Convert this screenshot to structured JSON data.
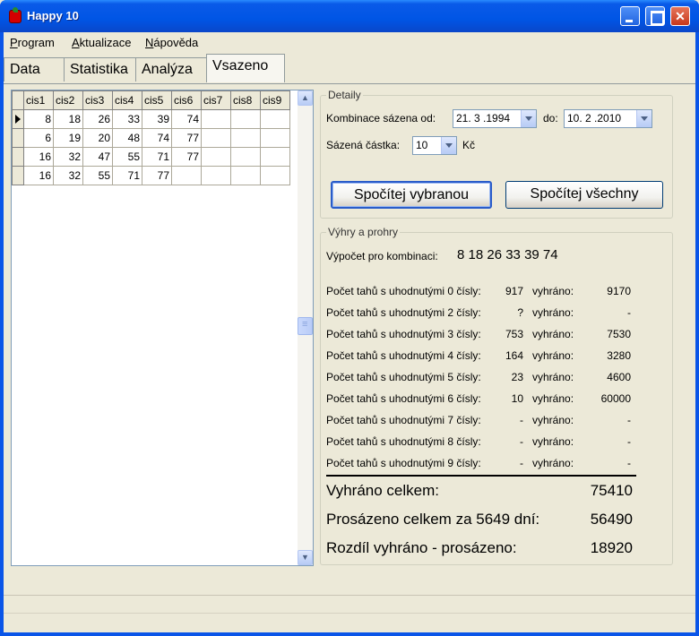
{
  "window": {
    "title": "Happy 10"
  },
  "menu": [
    {
      "label": "Program",
      "accel": "P"
    },
    {
      "label": "Aktualizace",
      "accel": "A"
    },
    {
      "label": "Nápověda",
      "accel": "N"
    }
  ],
  "tabs": [
    {
      "label": "Data"
    },
    {
      "label": "Statistika"
    },
    {
      "label": "Analýza"
    },
    {
      "label": "Vsazeno"
    }
  ],
  "grid": {
    "headers": [
      "cis1",
      "cis2",
      "cis3",
      "cis4",
      "cis5",
      "cis6",
      "cis7",
      "cis8",
      "cis9"
    ],
    "rows": [
      [
        "8",
        "18",
        "26",
        "33",
        "39",
        "74",
        "",
        "",
        ""
      ],
      [
        "6",
        "19",
        "20",
        "48",
        "74",
        "77",
        "",
        "",
        ""
      ],
      [
        "16",
        "32",
        "47",
        "55",
        "71",
        "77",
        "",
        "",
        ""
      ],
      [
        "16",
        "32",
        "55",
        "71",
        "77",
        "",
        "",
        "",
        ""
      ]
    ],
    "current_row": 0
  },
  "details": {
    "legend": "Detaily",
    "from_label": "Kombinace sázena od:",
    "from_value": "21. 3 .1994",
    "to_label": "do:",
    "to_value": "10. 2 .2010",
    "amount_label": "Sázená částka:",
    "amount_value": "10",
    "currency": "Kč",
    "btn_selected": "Spočítej vybranou",
    "btn_all": "Spočítej všechny"
  },
  "results": {
    "legend": "Výhry a prohry",
    "combo_label": "Výpočet pro kombinaci:",
    "combo_value": "8 18 26 33 39 74",
    "rows": [
      {
        "label": "Počet tahů s uhodnutými 0 čísly:",
        "count": "917",
        "won_label": "vyhráno:",
        "won": "9170"
      },
      {
        "label": "Počet tahů s uhodnutými 2 čísly:",
        "count": "?",
        "won_label": "vyhráno:",
        "won": "-"
      },
      {
        "label": "Počet tahů s uhodnutými 3 čísly:",
        "count": "753",
        "won_label": "vyhráno:",
        "won": "7530"
      },
      {
        "label": "Počet tahů s uhodnutými 4 čísly:",
        "count": "164",
        "won_label": "vyhráno:",
        "won": "3280"
      },
      {
        "label": "Počet tahů s uhodnutými 5 čísly:",
        "count": "23",
        "won_label": "vyhráno:",
        "won": "4600"
      },
      {
        "label": "Počet tahů s uhodnutými 6 čísly:",
        "count": "10",
        "won_label": "vyhráno:",
        "won": "60000"
      },
      {
        "label": "Počet tahů s uhodnutými 7 čísly:",
        "count": "-",
        "won_label": "vyhráno:",
        "won": "-"
      },
      {
        "label": "Počet tahů s uhodnutými 8 čísly:",
        "count": "-",
        "won_label": "vyhráno:",
        "won": "-"
      },
      {
        "label": "Počet tahů s uhodnutými 9 čísly:",
        "count": "-",
        "won_label": "vyhráno:",
        "won": "-"
      }
    ],
    "total_won_label": "Vyhráno celkem:",
    "total_won": "75410",
    "total_bet_label": "Prosázeno celkem za 5649 dní:",
    "total_bet": "56490",
    "diff_label": "Rozdíl vyhráno - prosázeno:",
    "diff": "18920"
  },
  "colors": {
    "titlebar": "#0055e5",
    "face": "#ece9d8",
    "close": "#c8381b"
  }
}
